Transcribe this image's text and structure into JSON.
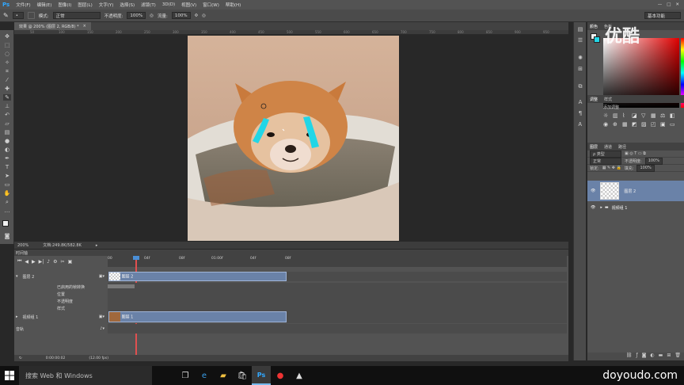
{
  "app": {
    "logo": "Ps"
  },
  "menu": [
    "文件(F)",
    "编辑(E)",
    "图像(I)",
    "图层(L)",
    "文字(Y)",
    "选择(S)",
    "滤镜(T)",
    "3D(D)",
    "视图(V)",
    "窗口(W)",
    "帮助(H)"
  ],
  "window_controls": [
    "—",
    "□",
    "✕"
  ],
  "options": {
    "mode_label": "模式:",
    "mode_value": "正常",
    "opacity_label": "不透明度:",
    "opacity_value": "100%",
    "flow_label": "流量:",
    "flow_value": "100%",
    "workspace": "基本功能"
  },
  "document": {
    "tab_title": "效果 @ 200% (图层 2, RGB/8) *",
    "ruler_ticks": [
      "50",
      "100",
      "150",
      "200",
      "250",
      "300",
      "350",
      "400",
      "450",
      "500",
      "550",
      "600",
      "650",
      "700",
      "750",
      "800",
      "850",
      "900",
      "950"
    ]
  },
  "status": {
    "zoom": "200%",
    "doc_info": "文档:249.8K/582.8K"
  },
  "timeline": {
    "panel_title": "时间轴",
    "ruler_labels": [
      "00",
      "04f",
      "08f",
      "01:00f",
      "04f",
      "08f"
    ],
    "rows": [
      {
        "label": "图层 2",
        "clip": "图层 2"
      },
      {
        "label": "已启用的帧转换",
        "sub": true
      },
      {
        "label": "位置",
        "sub": true
      },
      {
        "label": "不透明度",
        "sub": true
      },
      {
        "label": "样式",
        "sub": true
      },
      {
        "label": "视频组 1",
        "clip": "图层 1"
      },
      {
        "label": "音轨",
        "clip": ""
      }
    ],
    "footer_time": "0:00:00:02",
    "footer_fps": "(12.00 fps)"
  },
  "right_panel": {
    "color_tabs": [
      "颜色",
      "色板"
    ],
    "adjust_tabs": [
      "调整",
      "样式"
    ],
    "adjust_title": "添加调整",
    "layers_tabs": [
      "图层",
      "通道",
      "路径"
    ],
    "kind_filter": "ρ 类型",
    "blend_mode": "正常",
    "opacity_label": "不透明度:",
    "opacity_value": "100%",
    "lock_label": "锁定:",
    "fill_label": "填充:",
    "fill_value": "100%",
    "layers": [
      {
        "name": "图层 2",
        "selected": true
      },
      {
        "name": "视频组 1",
        "selected": false
      }
    ]
  },
  "taskbar": {
    "search_placeholder": "搜索 Web 和 Windows"
  },
  "watermarks": {
    "top_right": "优酷",
    "bottom_right": "doyoudo.com"
  },
  "colors": {
    "accent": "#31a8ff",
    "selection": "#6a82a8",
    "tear": "#22d6e6"
  }
}
